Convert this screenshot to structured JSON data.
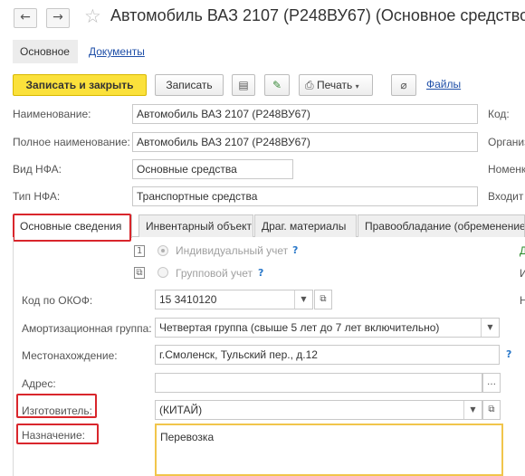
{
  "header": {
    "back_icon": "arrow-left",
    "forward_icon": "arrow-right",
    "title": "Автомобиль ВАЗ 2107 (Р248ВУ67) (Основное средство"
  },
  "sections": {
    "main": "Основное",
    "documents": "Документы"
  },
  "toolbar": {
    "save_close": "Записать и закрыть",
    "save": "Записать",
    "print": "Печать",
    "files": "Файлы"
  },
  "form": {
    "name_label": "Наименование:",
    "name_value": "Автомобиль ВАЗ 2107 (Р248ВУ67)",
    "full_name_label": "Полное наименование:",
    "full_name_value": "Автомобиль ВАЗ 2107 (Р248ВУ67)",
    "nfa_kind_label": "Вид НФА:",
    "nfa_kind_value": "Основные средства",
    "nfa_type_label": "Тип НФА:",
    "nfa_type_value": "Транспортные средства",
    "code_label": "Код:",
    "org_label": "Организ",
    "nomen_label": "Номенк",
    "incl_label": "Входит"
  },
  "tabs": {
    "basic": "Основные сведения",
    "inventory": "Инвентарный объект",
    "precious": "Драг. материалы",
    "rights": "Правообладание (обременение)"
  },
  "details": {
    "individual": "Индивидуальный учет",
    "group": "Групповой учет",
    "okof_label": "Код по ОКОФ:",
    "okof_value": "15 3410120",
    "amort_label": "Амортизационная группа:",
    "amort_value": "Четвертая группа (свыше 5 лет до 7 лет включительно)",
    "location_label": "Местонахождение:",
    "location_value": "г.Смоленск, Тульский пер., д.12",
    "address_label": "Адрес:",
    "address_value": "",
    "manufacturer_label": "Изготовитель:",
    "manufacturer_value": "(КИТАЙ)",
    "purpose_label": "Назначение:",
    "purpose_value": "Перевозка"
  },
  "right_cut": {
    "d": "Д",
    "i": "И",
    "n": "Н"
  },
  "colors": {
    "primary_button": "#fbe13b",
    "highlight": "#d9262c",
    "focus": "#f1c54b",
    "link": "#1f4fa8"
  }
}
